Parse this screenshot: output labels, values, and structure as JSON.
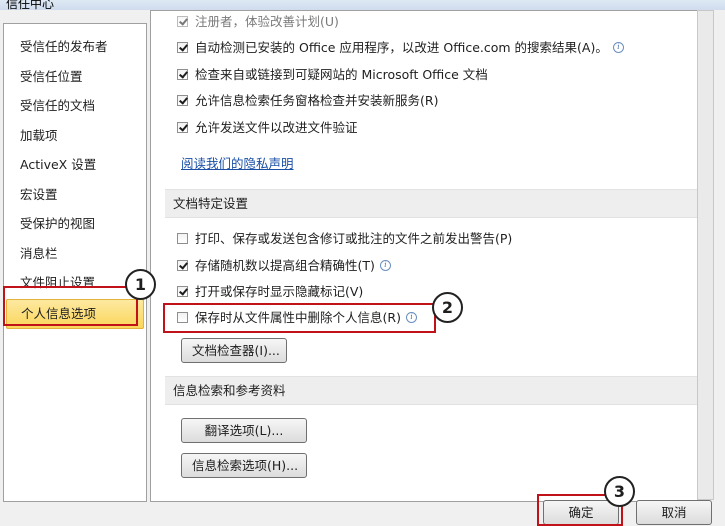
{
  "window": {
    "title": "信任中心"
  },
  "sidebar": {
    "items": [
      {
        "label": "受信任的发布者"
      },
      {
        "label": "受信任位置"
      },
      {
        "label": "受信任的文档"
      },
      {
        "label": "加载项"
      },
      {
        "label": "ActiveX 设置"
      },
      {
        "label": "宏设置"
      },
      {
        "label": "受保护的视图"
      },
      {
        "label": "消息栏"
      },
      {
        "label": "文件阻止设置"
      },
      {
        "label": "个人信息选项",
        "selected": true
      }
    ]
  },
  "main": {
    "top_options": [
      {
        "label": "注册者，体验改善计划(U)",
        "checked": true
      },
      {
        "label": "自动检测已安装的 Office 应用程序，以改进 Office.com 的搜索结果(A)。",
        "checked": true,
        "info": true
      },
      {
        "label": "检查来自或链接到可疑网站的 Microsoft Office 文档",
        "checked": true
      },
      {
        "label": "允许信息检索任务窗格检查并安装新服务(R)",
        "checked": true
      },
      {
        "label": "允许发送文件以改进文件验证",
        "checked": true
      }
    ],
    "privacy_link": "阅读我们的隐私声明",
    "doc_section": {
      "header": "文档特定设置",
      "options": [
        {
          "label": "打印、保存或发送包含修订或批注的文件之前发出警告(P)",
          "checked": false
        },
        {
          "label": "存储随机数以提高组合精确性(T)",
          "checked": true,
          "info": true
        },
        {
          "label": "打开或保存时显示隐藏标记(V)",
          "checked": true
        },
        {
          "label": "保存时从文件属性中删除个人信息(R)",
          "checked": false,
          "info": true
        }
      ],
      "inspector_button": "文档检查器(I)..."
    },
    "research_section": {
      "header": "信息检索和参考资料",
      "translation_button": "翻译选项(L)...",
      "research_button": "信息检索选项(H)..."
    }
  },
  "footer": {
    "ok_label": "确定",
    "cancel_label": "取消"
  },
  "callouts": {
    "step1": "1",
    "step2": "2",
    "step3": "3"
  },
  "colors": {
    "highlight": "#c1121a",
    "selected_bg": "#fbd65a",
    "link": "#1a4fa5"
  }
}
